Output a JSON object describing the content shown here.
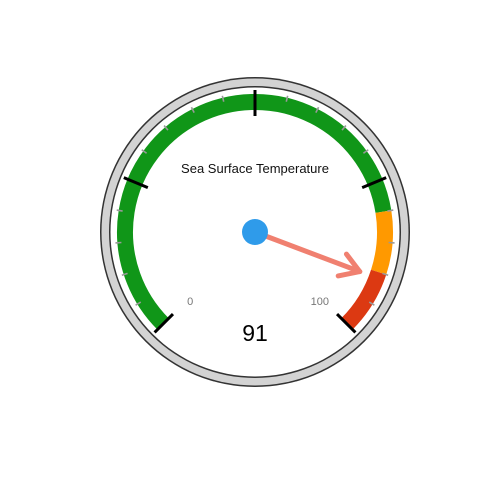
{
  "chart_data": {
    "type": "gauge",
    "title": "Sea Surface Temperature",
    "value": 91,
    "value_label": "91",
    "min": 0,
    "max": 100,
    "min_label": "0",
    "max_label": "100",
    "bands": [
      {
        "from": 0,
        "to": 80,
        "color": "#109618"
      },
      {
        "from": 80,
        "to": 90,
        "color": "#FF9900"
      },
      {
        "from": 90,
        "to": 100,
        "color": "#DC3912"
      }
    ],
    "major_ticks": [
      0,
      25,
      50,
      75,
      100
    ],
    "minor_ticks_per_major": 4
  },
  "colors": {
    "needle": "#F08070",
    "hub": "#2F9BEA",
    "rim": "#D3D3D3",
    "outline": "#333333",
    "major_tick": "#000000",
    "minor_tick": "#999999"
  }
}
